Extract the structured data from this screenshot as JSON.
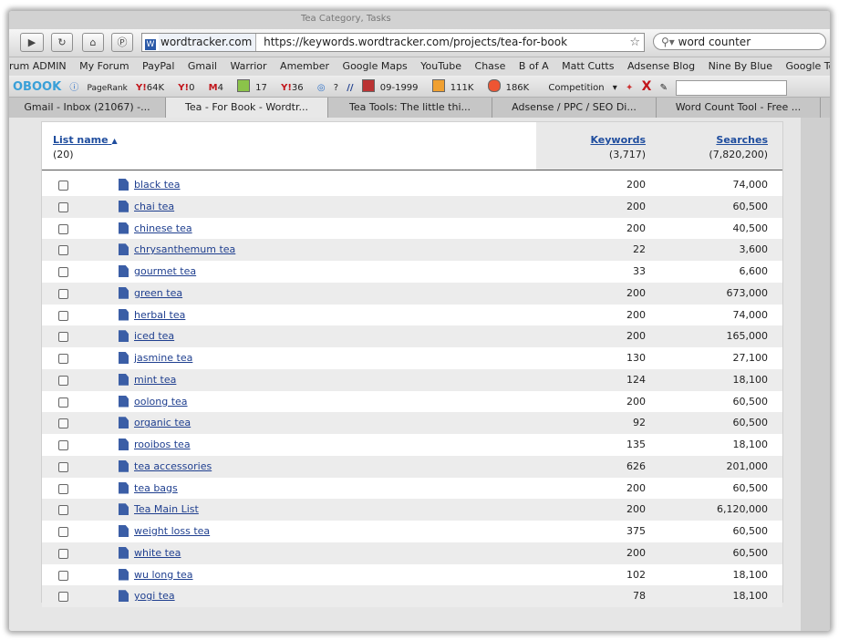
{
  "browser": {
    "faint_title": "Tea Category, Tasks",
    "url_host": "wordtracker.com",
    "url_path": "https://keywords.wordtracker.com/projects/tea-for-book",
    "search_text": "word counter"
  },
  "bookmarks": [
    "rum ADMIN",
    "My Forum",
    "PayPal",
    "Gmail",
    "Warrior",
    "Amember",
    "Google Maps",
    "YouTube",
    "Chase",
    "B of A",
    "Matt Cutts",
    "Adsense Blog",
    "Nine By Blue",
    "Google Tool"
  ],
  "toolbar": {
    "logo": "OBOOK",
    "pagerank": "PageRank",
    "y_links": "64K",
    "y_zero": "0",
    "msn": "4",
    "d_val": "17",
    "y_36": "36",
    "question": "?",
    "date": "09-1999",
    "count1": "111K",
    "count2": "186K",
    "competition": "Competition"
  },
  "tabs": [
    {
      "label": "Gmail - Inbox (21067) -..."
    },
    {
      "label": "Tea - For Book - Wordtr..."
    },
    {
      "label": "Tea Tools: The little thi..."
    },
    {
      "label": "Adsense / PPC / SEO Di..."
    },
    {
      "label": "Word Count Tool - Free ..."
    }
  ],
  "table": {
    "col_name": "List name",
    "col_name_count": "(20)",
    "col_keywords": "Keywords",
    "col_keywords_total": "(3,717)",
    "col_searches": "Searches",
    "col_searches_total": "(7,820,200)",
    "rows": [
      {
        "name": "black tea",
        "keywords": "200",
        "searches": "74,000"
      },
      {
        "name": "chai tea",
        "keywords": "200",
        "searches": "60,500"
      },
      {
        "name": "chinese tea",
        "keywords": "200",
        "searches": "40,500"
      },
      {
        "name": "chrysanthemum tea",
        "keywords": "22",
        "searches": "3,600"
      },
      {
        "name": "gourmet tea",
        "keywords": "33",
        "searches": "6,600"
      },
      {
        "name": "green tea",
        "keywords": "200",
        "searches": "673,000"
      },
      {
        "name": "herbal tea",
        "keywords": "200",
        "searches": "74,000"
      },
      {
        "name": "iced tea",
        "keywords": "200",
        "searches": "165,000"
      },
      {
        "name": "jasmine tea",
        "keywords": "130",
        "searches": "27,100"
      },
      {
        "name": "mint tea",
        "keywords": "124",
        "searches": "18,100"
      },
      {
        "name": "oolong tea",
        "keywords": "200",
        "searches": "60,500"
      },
      {
        "name": "organic tea",
        "keywords": "92",
        "searches": "60,500"
      },
      {
        "name": "rooibos tea",
        "keywords": "135",
        "searches": "18,100"
      },
      {
        "name": "tea accessories",
        "keywords": "626",
        "searches": "201,000"
      },
      {
        "name": "tea bags",
        "keywords": "200",
        "searches": "60,500"
      },
      {
        "name": "Tea Main List",
        "keywords": "200",
        "searches": "6,120,000"
      },
      {
        "name": "weight loss tea",
        "keywords": "375",
        "searches": "60,500"
      },
      {
        "name": "white tea",
        "keywords": "200",
        "searches": "60,500"
      },
      {
        "name": "wu long tea",
        "keywords": "102",
        "searches": "18,100"
      },
      {
        "name": "yogi tea",
        "keywords": "78",
        "searches": "18,100"
      }
    ]
  }
}
